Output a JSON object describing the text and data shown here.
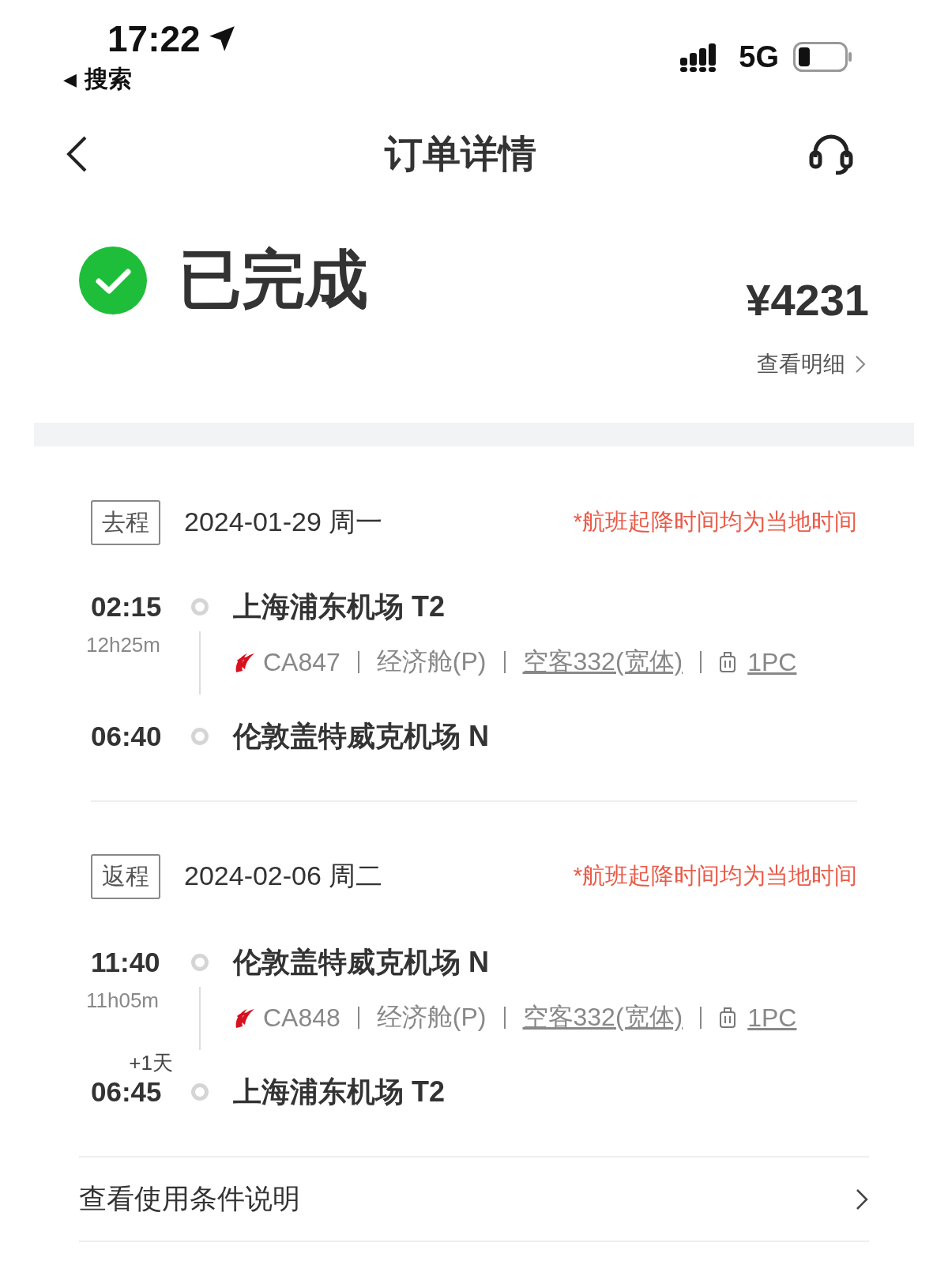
{
  "status_bar": {
    "time": "17:22",
    "back_arrow": "◀",
    "back_app": "搜索",
    "network": "5G"
  },
  "nav": {
    "title": "订单详情"
  },
  "order": {
    "status": "已完成",
    "price": "¥4231",
    "detail_link": "查看明细"
  },
  "trips": [
    {
      "tag": "去程",
      "date": "2024-01-29 周一",
      "note": "*航班起降时间均为当地时间",
      "departure": {
        "time": "02:15",
        "airport": "上海浦东机场 T2"
      },
      "duration": "12h25m",
      "flight": {
        "number": "CA847",
        "cabin": "经济舱(P)",
        "aircraft": "空客332(宽体)",
        "baggage": "1PC"
      },
      "arrival": {
        "time": "06:40",
        "airport": "伦敦盖特威克机场 N"
      }
    },
    {
      "tag": "返程",
      "date": "2024-02-06 周二",
      "note": "*航班起降时间均为当地时间",
      "departure": {
        "time": "11:40",
        "airport": "伦敦盖特威克机场 N"
      },
      "duration": "11h05m",
      "flight": {
        "number": "CA848",
        "cabin": "经济舱(P)",
        "aircraft": "空客332(宽体)",
        "baggage": "1PC"
      },
      "arrival": {
        "time": "06:45",
        "day_offset": "+1天",
        "airport": "上海浦东机场 T2"
      }
    }
  ],
  "footer": {
    "link": "查看使用条件说明"
  }
}
